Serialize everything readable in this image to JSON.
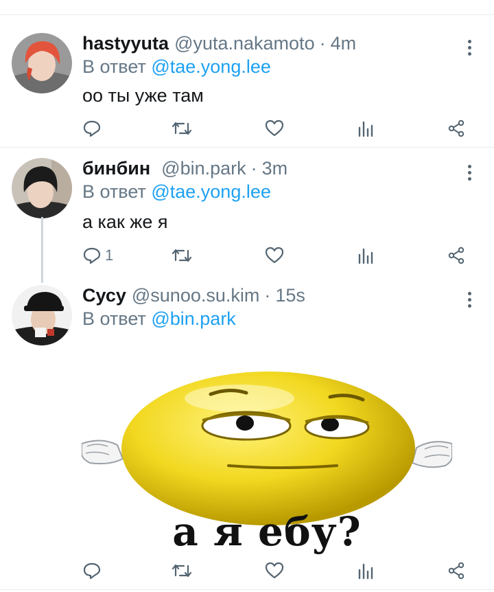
{
  "tweets": [
    {
      "name": "hastyyuta",
      "handle": "@yuta.nakamoto",
      "separator": "·",
      "time": "4m",
      "reply_prefix": "В ответ",
      "reply_to": "@tae.yong.lee",
      "text": "оо ты уже там",
      "reply_count": ""
    },
    {
      "name": "бинбин",
      "handle": "@bin.park",
      "separator": "·",
      "time": "3m",
      "reply_prefix": "В ответ",
      "reply_to": "@tae.yong.lee",
      "text": "а как же я",
      "reply_count": "1"
    },
    {
      "name": "Сусу",
      "handle": "@sunoo.su.kim",
      "separator": "·",
      "time": "15s",
      "reply_prefix": "В ответ",
      "reply_to": "@bin.park",
      "text": "",
      "reply_count": "",
      "media": {
        "caption": "а я ебу?"
      }
    }
  ],
  "icons": {
    "reply": "reply-icon",
    "retweet": "retweet-icon",
    "like": "heart-icon",
    "stats": "stats-icon",
    "share": "share-icon",
    "more": "more-icon"
  },
  "colors": {
    "mention": "#1da1f2",
    "secondary": "#657786",
    "divider": "#e6ecf0",
    "thread_line": "#ccd6dd"
  }
}
